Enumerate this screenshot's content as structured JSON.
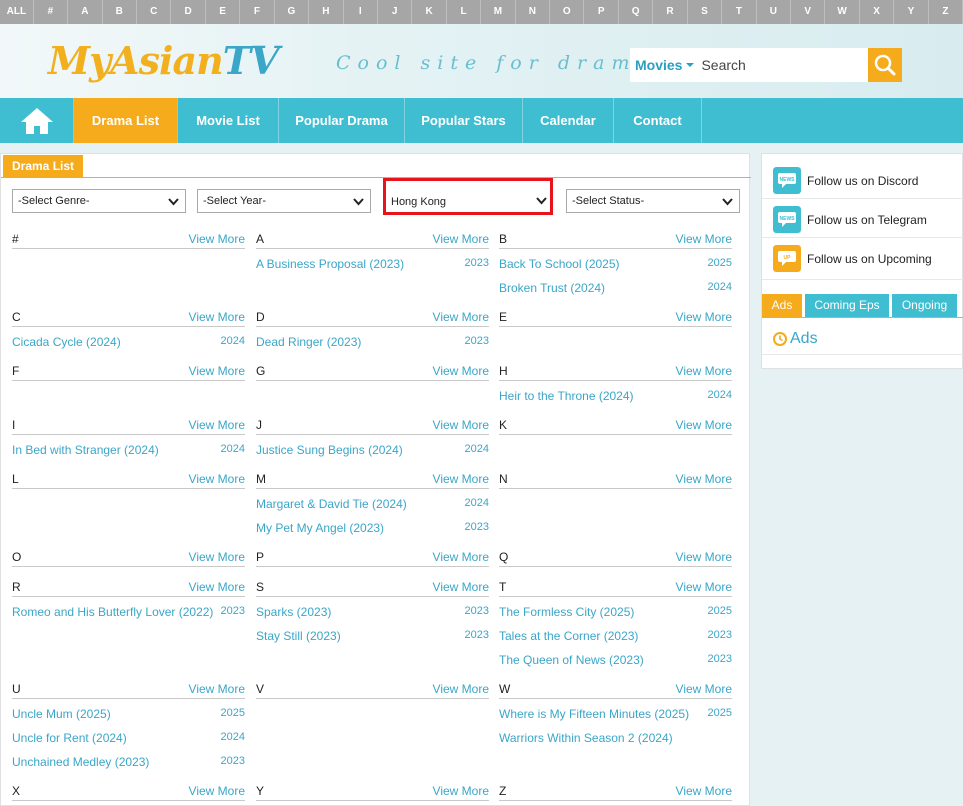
{
  "alpha_bar": [
    "ALL",
    "#",
    "A",
    "B",
    "C",
    "D",
    "E",
    "F",
    "G",
    "H",
    "I",
    "J",
    "K",
    "L",
    "M",
    "N",
    "O",
    "P",
    "Q",
    "R",
    "S",
    "T",
    "U",
    "V",
    "W",
    "X",
    "Y",
    "Z"
  ],
  "header": {
    "logo_my": "My",
    "logo_asian": "Asian",
    "logo_tv": "TV",
    "tagline": "Cool site for dramas",
    "search_type": "Movies",
    "search_placeholder": "Search"
  },
  "nav": {
    "items": [
      "Drama List",
      "Movie List",
      "Popular Drama",
      "Popular Stars",
      "Calendar",
      "Contact"
    ]
  },
  "panel": {
    "title": "Drama List"
  },
  "filters": {
    "genre": "-Select Genre-",
    "year": "-Select Year-",
    "country": "Hong Kong",
    "status": "-Select Status-"
  },
  "view_more_label": "View More",
  "letters": {
    "hash": "#",
    "A": "A",
    "B": "B",
    "C": "C",
    "D": "D",
    "E": "E",
    "F": "F",
    "G": "G",
    "H": "H",
    "I": "I",
    "J": "J",
    "K": "K",
    "L": "L",
    "M": "M",
    "N": "N",
    "O": "O",
    "P": "P",
    "Q": "Q",
    "R": "R",
    "S": "S",
    "T": "T",
    "U": "U",
    "V": "V",
    "W": "W",
    "X": "X",
    "Y": "Y",
    "Z": "Z"
  },
  "dramas": {
    "A": [
      {
        "title": "A Business Proposal (2023)",
        "year": "2023"
      }
    ],
    "B": [
      {
        "title": "Back To School (2025)",
        "year": "2025"
      },
      {
        "title": "Broken Trust (2024)",
        "year": "2024"
      }
    ],
    "C": [
      {
        "title": "Cicada Cycle (2024)",
        "year": "2024"
      }
    ],
    "D": [
      {
        "title": "Dead Ringer (2023)",
        "year": "2023"
      }
    ],
    "H": [
      {
        "title": "Heir to the Throne (2024)",
        "year": "2024"
      }
    ],
    "I": [
      {
        "title": "In Bed with Stranger (2024)",
        "year": "2024"
      }
    ],
    "J": [
      {
        "title": "Justice Sung Begins (2024)",
        "year": "2024"
      }
    ],
    "M": [
      {
        "title": "Margaret & David Tie (2024)",
        "year": "2024"
      },
      {
        "title": "My Pet My Angel (2023)",
        "year": "2023"
      }
    ],
    "R": [
      {
        "title": "Romeo and His Butterfly Lover (2022)",
        "year": "2023"
      }
    ],
    "S": [
      {
        "title": "Sparks (2023)",
        "year": "2023"
      },
      {
        "title": "Stay Still (2023)",
        "year": "2023"
      }
    ],
    "T": [
      {
        "title": "The Formless City (2025)",
        "year": "2025"
      },
      {
        "title": "Tales at the Corner (2023)",
        "year": "2023"
      },
      {
        "title": "The Queen of News (2023)",
        "year": "2023"
      }
    ],
    "U": [
      {
        "title": "Uncle Mum (2025)",
        "year": "2025"
      },
      {
        "title": "Uncle for Rent (2024)",
        "year": "2024"
      },
      {
        "title": "Unchained Medley (2023)",
        "year": "2023"
      }
    ],
    "W": [
      {
        "title": "Where is My Fifteen Minutes (2025)",
        "year": "2025"
      },
      {
        "title": "Warriors Within Season 2 (2024)",
        "year": ""
      }
    ]
  },
  "sidebar": {
    "follow": [
      "Follow us on Discord",
      "Follow us on Telegram",
      "Follow us on Upcoming"
    ],
    "icon_news": "NEWS",
    "icon_up": "UP",
    "tabs": [
      "Ads",
      "Coming Eps",
      "Ongoing"
    ],
    "ads_title": "Ads"
  },
  "colors": {
    "accent_orange": "#f5ab1b",
    "accent_teal": "#3fbed1",
    "link_blue": "#3aa6c8",
    "highlight_red": "#e8131b"
  }
}
